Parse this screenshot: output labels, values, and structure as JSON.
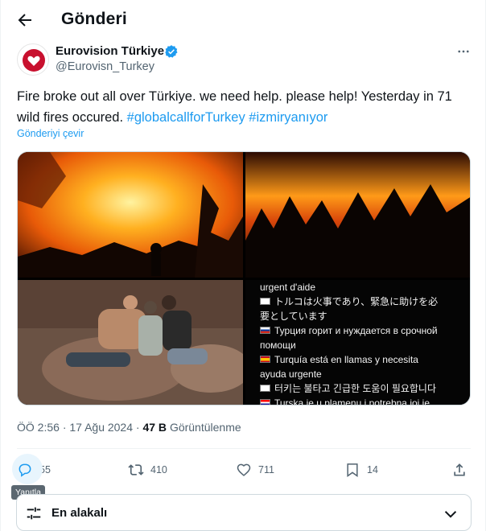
{
  "header": {
    "title": "Gönderi"
  },
  "author": {
    "name": "Eurovision Türkiye",
    "handle": "@Eurovisn_Turkey"
  },
  "tweet": {
    "text_plain": "Fire broke out all over Türkiye. we need help. please help! Yesterday in 71 wild fires occured.",
    "hashtag_1": "#globalcallforTurkey",
    "hashtag_2": "#izmiryanıyor",
    "translate_label": "Gönderiyi çevir"
  },
  "media": {
    "captions": [
      "urgent d'aide",
      "トルコは火事であり、緊急に助けを必",
      "要としています",
      "Турция горит и нуждается в срочной",
      "помощи",
      "Turquía está en llamas y necesita",
      "ayuda urgente",
      "터키는 불타고 긴급한 도움이 필요합니다",
      "Turska je u plamenu i potrebna joj je"
    ]
  },
  "meta": {
    "time": "ÖÖ 2:56",
    "separator": "·",
    "date": "17 Ağu 2024",
    "views_count": "47 B",
    "views_label": "Görüntülenme"
  },
  "actions": {
    "reply_count": "55",
    "retweet_count": "410",
    "like_count": "711",
    "bookmark_count": "14"
  },
  "tooltip": {
    "reply": "Yanıtla"
  },
  "sort": {
    "label": "En alakalı"
  },
  "colors": {
    "accent": "#1d9bf0",
    "muted": "#536471",
    "text": "#0f1419",
    "verified": "#1d9bf0",
    "avatar_heart": "#c8102e"
  },
  "icons": {
    "back": "arrow-left-icon",
    "verified": "verified-badge-icon",
    "more": "more-dots-icon",
    "reply": "reply-bubble-icon",
    "retweet": "retweet-icon",
    "like": "heart-icon",
    "bookmark": "bookmark-icon",
    "share": "share-icon",
    "sort": "sliders-icon",
    "chevron": "chevron-down-icon"
  }
}
